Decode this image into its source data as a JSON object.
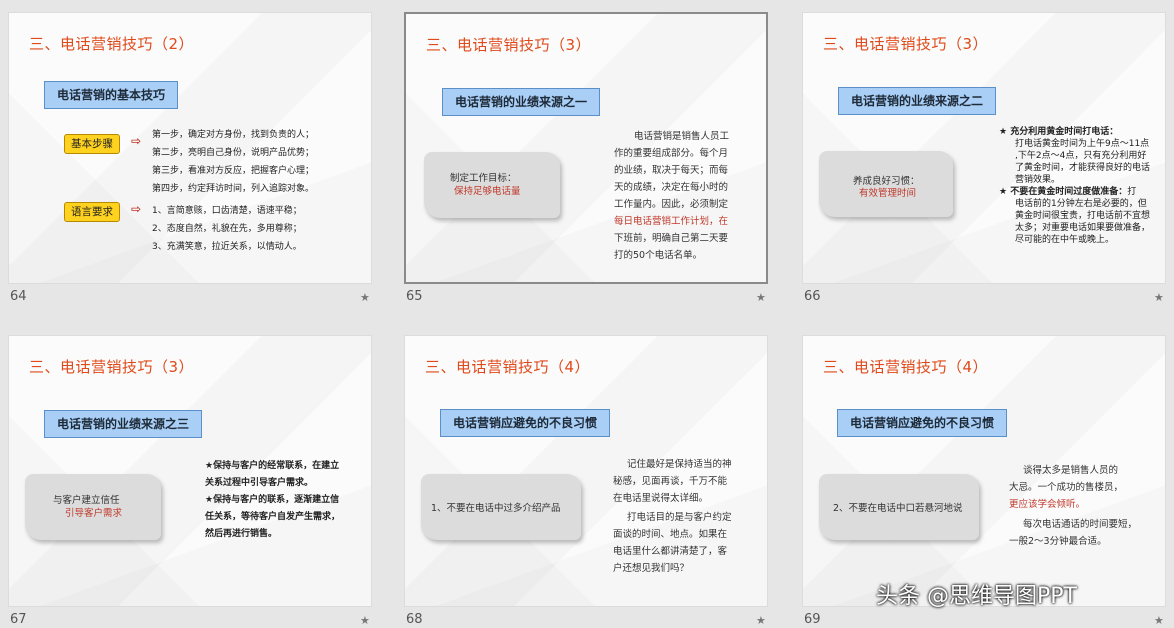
{
  "slides": [
    {
      "number": "64",
      "title": "三、电话营销技巧（2）",
      "box_title": "电话营销的基本技巧",
      "tag1": "基本步骤",
      "tag1_lines": [
        "第一步，确定对方身份，找到负责的人；",
        "第二步，亮明自己身份，说明产品优势；",
        "第三步，看准对方反应，把握客户心理；",
        "第四步，约定拜访时间，列入追踪对象。"
      ],
      "tag2": "语言要求",
      "tag2_lines": [
        "1、言简意赅，口齿清楚，语速平稳；",
        "2、态度自然，礼貌在先，多用尊称；",
        "3、充满笑意，拉近关系，以情动人。"
      ]
    },
    {
      "number": "65",
      "title": "三、电话营销技巧（3）",
      "box_title": "电话营销的业绩来源之一",
      "paper_line1": "制定工作目标：",
      "paper_line2": "保持足够电话量",
      "body": [
        "电话营销是销售人员工",
        "作的重要组成部分。每个月",
        "的业绩，取决于每天；而每",
        "天的成绩，决定在每小时的",
        "工作量内。因此，必须制定",
        "每日电话营销工作计划，在",
        "下班前，明确自己第二天要",
        "打的50个电话名单。"
      ]
    },
    {
      "number": "66",
      "title": "三、电话营销技巧（3）",
      "box_title": "电话营销的业绩来源之二",
      "paper_line1": "养成良好习惯：",
      "paper_line2": "有效管理时间",
      "bullet1": "充分利用黄金时间打电话：",
      "bullet1_lines": [
        "打电话黄金时间为上午9点～11点",
        ",下午2点～4点，只有充分利用好",
        "了黄金时间，才能获得良好的电话",
        "营销效果。"
      ],
      "bullet2": "不要在黄金时间过度做准备：",
      "bullet2_lines": [
        "打",
        "电话前的1分钟左右是必要的，但",
        "黄金时间很宝贵，打电话前不宜想",
        "太多；对重要电话如果要做准备，",
        "尽可能的在中午或晚上。"
      ]
    },
    {
      "number": "67",
      "title": "三、电话营销技巧（3）",
      "box_title": "电话营销的业绩来源之三",
      "paper_line1": "与客户建立信任",
      "paper_line2": "引导客户需求",
      "lines": [
        "★保持与客户的经常联系，在建立",
        "关系过程中引导客户需求。",
        "★保持与客户的联系，逐渐建立信",
        "任关系，等待客户自发产生需求，",
        "然后再进行销售。"
      ]
    },
    {
      "number": "68",
      "title": "三、电话营销技巧（4）",
      "box_title": "电话营销应避免的不良习惯",
      "paper_line1": "1、不要在电话中过多介绍产品",
      "body1": [
        "记住最好是保持适当的神",
        "秘感，见面再谈，千万不能",
        "在电话里说得太详细。"
      ],
      "body2": [
        "打电话目的是与客户约定",
        "面谈的时间、地点。如果在",
        "电话里什么都讲清楚了，客",
        "户还想见我们吗？"
      ]
    },
    {
      "number": "69",
      "title": "三、电话营销技巧（4）",
      "box_title": "电话营销应避免的不良习惯",
      "paper_line1": "2、不要在电话中口若悬河地说",
      "body1": [
        "谈得太多是销售人员的",
        "大忌。一个成功的售楼员，",
        "更应该学会倾听。"
      ],
      "body2": [
        "每次电话通话的时间要短，",
        "一般2～3分钟最合适。"
      ]
    }
  ],
  "watermark": "头条 @思维导图PPT",
  "colors": {
    "title_red": "#e04a1a",
    "highlight_red": "#c0392b",
    "box_blue": "#a9cff7",
    "tag_yellow": "#ffd21f"
  },
  "icons": {
    "slide_star": "star-icon"
  },
  "star_glyph": "★"
}
